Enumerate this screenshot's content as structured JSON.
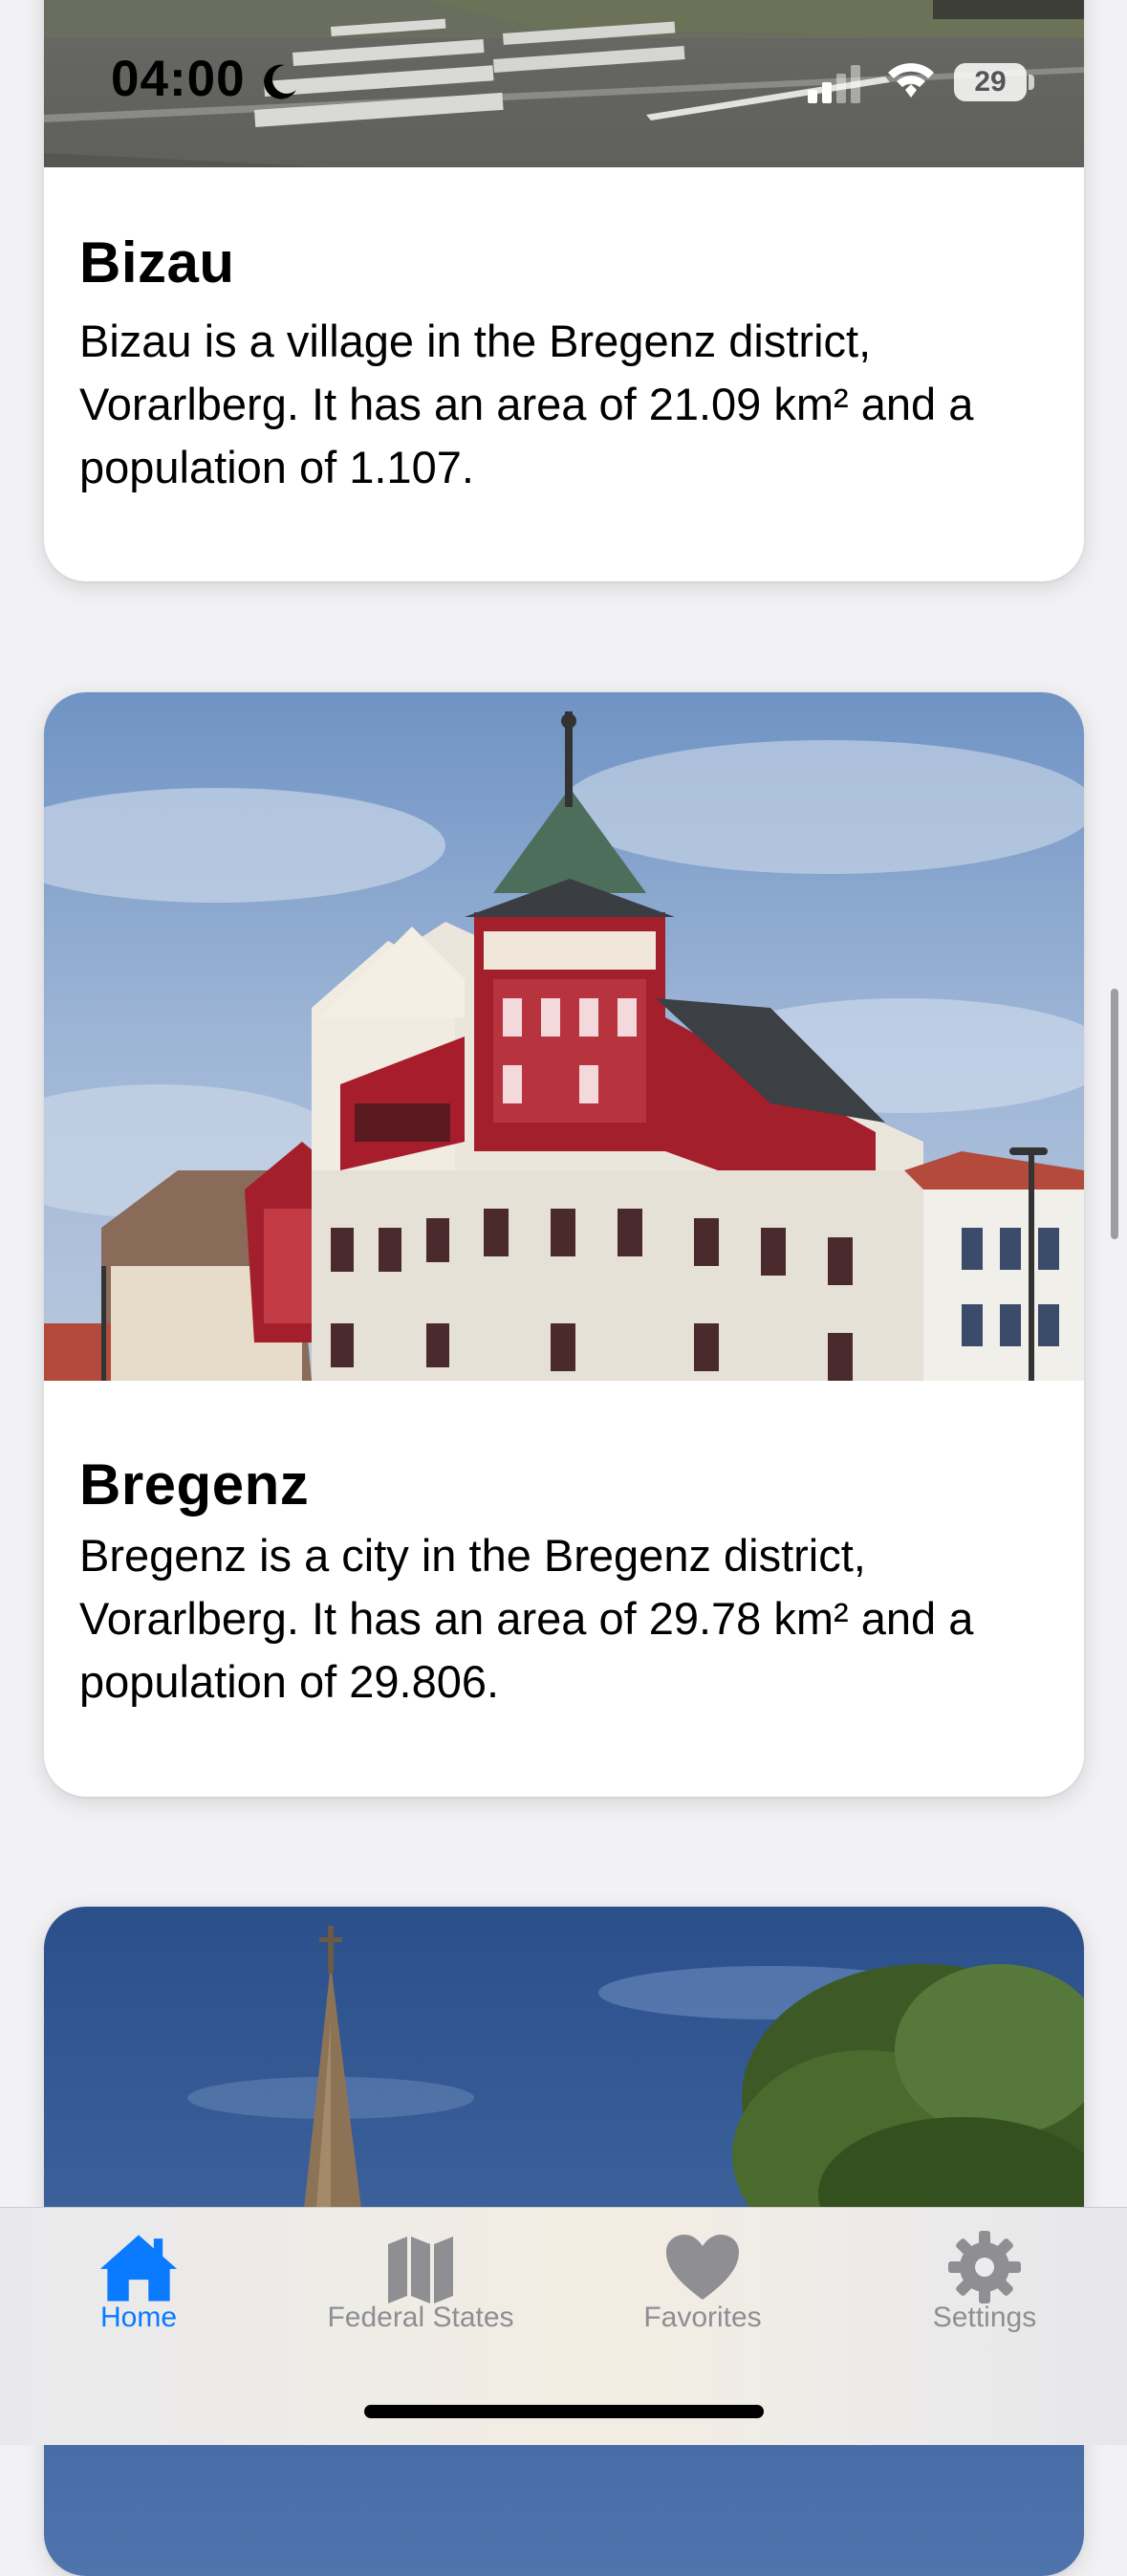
{
  "status_bar": {
    "time": "04:00",
    "battery": "29"
  },
  "cards": [
    {
      "title": "Bizau",
      "description": "Bizau is a village in the Bregenz district, Vorarlberg. It has an area of 21.09 km² and a population of 1.107."
    },
    {
      "title": "Bregenz",
      "description": "Bregenz is a city in the Bregenz district, Vorarlberg. It has an area of 29.78 km² and a population of 29.806."
    },
    {
      "title": "",
      "description": ""
    }
  ],
  "tab_bar": {
    "tabs": [
      {
        "label": "Home",
        "icon": "house-icon",
        "selected": true
      },
      {
        "label": "Federal States",
        "icon": "map-icon",
        "selected": false
      },
      {
        "label": "Favorites",
        "icon": "heart-icon",
        "selected": false
      },
      {
        "label": "Settings",
        "icon": "gear-icon",
        "selected": false
      }
    ]
  },
  "colors": {
    "accent": "#0a7aff",
    "inactive": "#8e8e93"
  }
}
